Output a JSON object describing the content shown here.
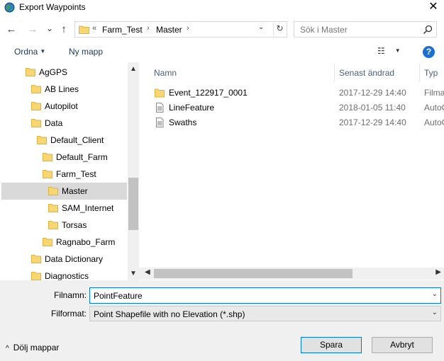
{
  "window": {
    "title": "Export Waypoints",
    "close_glyph": "✕",
    "app_icon": "globe-app-icon"
  },
  "nav": {
    "back_glyph": "←",
    "forward_glyph": "→",
    "recent_glyph": "⌄",
    "up_glyph": "↑",
    "address": {
      "overflow": "«",
      "crumbs": [
        "Farm_Test",
        "Master"
      ],
      "sep": "›",
      "dropdown_glyph": "⌄",
      "refresh_glyph": "↻"
    },
    "search": {
      "placeholder": "Sök i Master"
    }
  },
  "toolbar": {
    "organize_label": "Ordna",
    "new_folder_label": "Ny mapp",
    "view_glyph": "☷",
    "help_glyph": "?"
  },
  "tree": {
    "items": [
      {
        "label": "AgGPS",
        "level": 1
      },
      {
        "label": "AB Lines",
        "level": 2
      },
      {
        "label": "Autopilot",
        "level": 2
      },
      {
        "label": "Data",
        "level": 2
      },
      {
        "label": "Default_Client",
        "level": 3
      },
      {
        "label": "Default_Farm",
        "level": 4
      },
      {
        "label": "Farm_Test",
        "level": 4
      },
      {
        "label": "Master",
        "level": 5,
        "selected": true
      },
      {
        "label": "SAM_Internet",
        "level": 5
      },
      {
        "label": "Torsas",
        "level": 5
      },
      {
        "label": "Ragnabo_Farm",
        "level": 4
      },
      {
        "label": "Data Dictionary",
        "level": 2
      },
      {
        "label": "Diagnostics",
        "level": 2
      }
    ],
    "scroll_up": "▲",
    "scroll_down": "▼"
  },
  "filelist": {
    "columns": {
      "name": "Namn",
      "modified": "Senast ändrad",
      "type": "Typ"
    },
    "sort_glyph": "⌃",
    "rows": [
      {
        "name": "Event_122917_0001",
        "modified": "2017-12-29 14:40",
        "type": "Filma",
        "kind": "folder"
      },
      {
        "name": "LineFeature",
        "modified": "2018-01-05 11:40",
        "type": "AutoC",
        "kind": "file"
      },
      {
        "name": "Swaths",
        "modified": "2017-12-29 14:40",
        "type": "AutoC",
        "kind": "file"
      }
    ],
    "scroll_left": "◀",
    "scroll_right": "▶"
  },
  "form": {
    "filename_label": "Filnamn:",
    "filename_value": "PointFeature",
    "format_label": "Filformat:",
    "format_value": "Point Shapefile with no Elevation (*.shp)",
    "dropdown_glyph": "⌄"
  },
  "footer": {
    "hide_folders_label": "Dölj mappar",
    "hide_caret": "^",
    "save_label": "Spara",
    "cancel_label": "Avbryt"
  },
  "colors": {
    "folder": "#f7d674",
    "folder_edge": "#e2b33b",
    "accent": "#0078d7",
    "selected": "#d9d9d9"
  }
}
